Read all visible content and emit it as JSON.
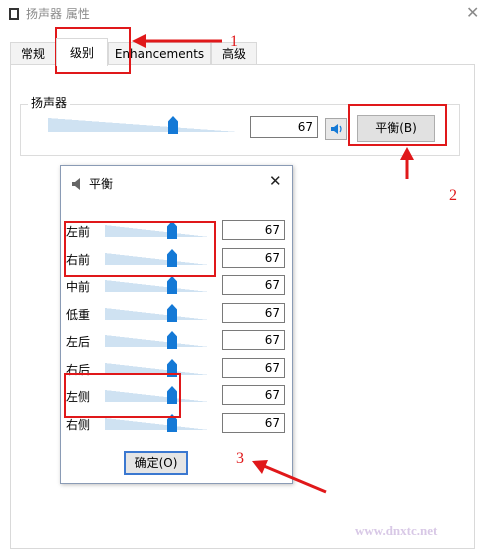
{
  "window": {
    "title": "扬声器 属性",
    "close_glyph": "✕"
  },
  "tabs": [
    {
      "label": "常规"
    },
    {
      "label": "级别"
    },
    {
      "label": "Enhancements"
    },
    {
      "label": "高级"
    }
  ],
  "levels": {
    "group_label": "扬声器",
    "speaker_value": "67",
    "speaker_level_percent": 67,
    "balance_button": "平衡(B)"
  },
  "balance_dialog": {
    "title": "平衡",
    "close_glyph": "✕",
    "channels": [
      {
        "label": "左前",
        "value": "67"
      },
      {
        "label": "右前",
        "value": "67"
      },
      {
        "label": "中前",
        "value": "67"
      },
      {
        "label": "低重",
        "value": "67"
      },
      {
        "label": "左后",
        "value": "67"
      },
      {
        "label": "右后",
        "value": "67"
      },
      {
        "label": "左侧",
        "value": "67"
      },
      {
        "label": "右侧",
        "value": "67"
      }
    ],
    "ok_button": "确定(O)"
  },
  "annotations": {
    "step1": "1",
    "step2": "2",
    "step3": "3",
    "annotation_color": "#e0181a"
  },
  "watermark": "www.dnxtc.net",
  "colors": {
    "accent": "#1479d6",
    "track_fill": "#cfe2f2"
  },
  "icons": {
    "window_icon": "speaker-icon",
    "mute_icon": "volume-icon",
    "dialog_icon": "speaker-icon"
  }
}
